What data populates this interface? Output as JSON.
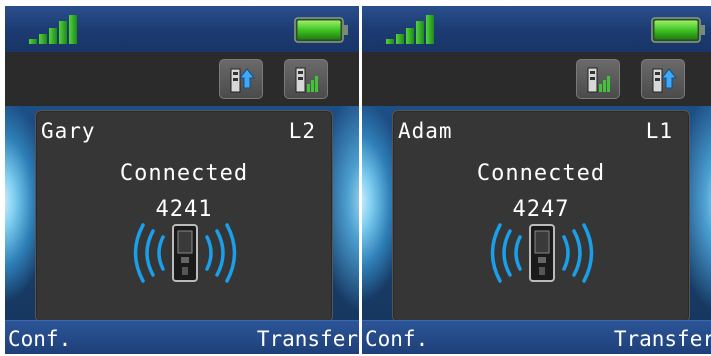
{
  "screens": [
    {
      "caller_name": "Gary",
      "line": "L2",
      "status": "Connected",
      "number": "4241",
      "left_softkey": "Conf.",
      "right_softkey": "Transfer",
      "toolbar_icons": [
        "contacts-up-icon",
        "signal-bars-icon"
      ]
    },
    {
      "caller_name": "Adam",
      "line": "L1",
      "status": "Connected",
      "number": "4247",
      "left_softkey": "Conf.",
      "right_softkey": "Transfer",
      "toolbar_icons": [
        "signal-bars-icon",
        "contacts-up-icon"
      ]
    }
  ],
  "colors": {
    "status_bar": "#1d3c73",
    "toolbar": "#2b2b2b",
    "card": "#363636",
    "accent_blue": "#1a9be6",
    "signal_green": "#2fb62f",
    "softkey_bar": "#244a89"
  },
  "signal_level": 5,
  "battery_level": 1.0
}
